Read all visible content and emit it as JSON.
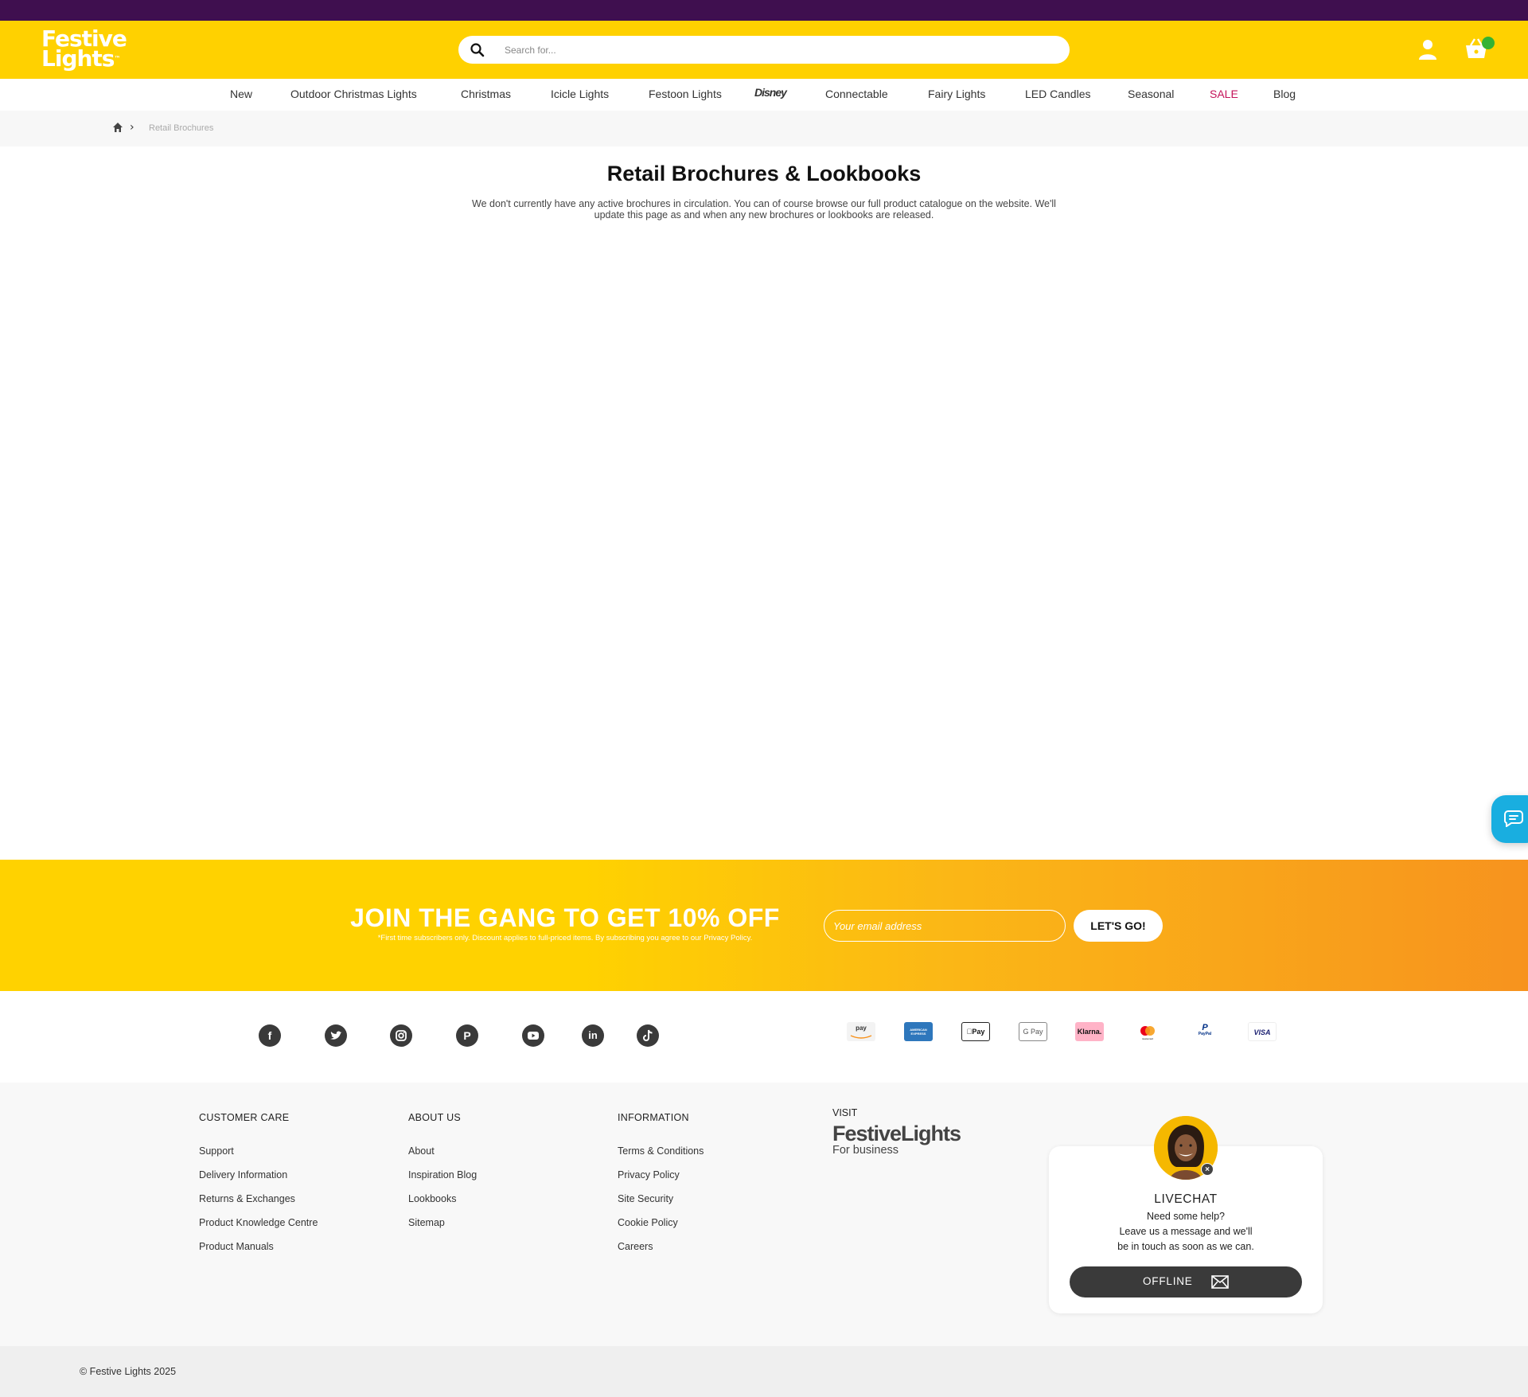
{
  "header": {
    "logo_line1": "Festive",
    "logo_line2": "Lights",
    "search_placeholder": "Search for..."
  },
  "nav": {
    "items": [
      "New",
      "Outdoor Christmas Lights",
      "Christmas",
      "Icicle Lights",
      "Festoon Lights",
      "Disney",
      "Connectable",
      "Fairy Lights",
      "LED Candles",
      "Seasonal",
      "SALE",
      "Blog"
    ]
  },
  "breadcrumb": {
    "current": "Retail Brochures"
  },
  "main": {
    "title": "Retail Brochures & Lookbooks",
    "description": "We don't currently have any active brochures in circulation. You can of course browse our full product catalogue on the website. We'll update this page as and when any new brochures or lookbooks are released."
  },
  "newsletter": {
    "heading": "JOIN THE GANG TO GET 10% OFF",
    "subtext": "*First time subscribers only. Discount applies to full-priced items. By subscribing you agree to our Privacy Policy.",
    "email_placeholder": "Your email address",
    "button_label": "LET'S GO!"
  },
  "social": [
    "facebook-icon",
    "twitter-icon",
    "instagram-icon",
    "pinterest-icon",
    "youtube-icon",
    "linkedin-icon",
    "tiktok-icon"
  ],
  "payments": {
    "amazon": "pay",
    "amex": "AMERICAN EXPRESS",
    "applepay": "Pay",
    "googlepay": "G Pay",
    "klarna": "Klarna.",
    "mastercard": "mastercard",
    "paypal": "PayPal",
    "visa": "VISA"
  },
  "footer": {
    "customer_care": {
      "heading": "CUSTOMER CARE",
      "links": [
        "Support",
        "Delivery Information",
        "Returns & Exchanges",
        "Product Knowledge Centre",
        "Product Manuals"
      ]
    },
    "about_us": {
      "heading": "ABOUT US",
      "links": [
        "About",
        "Inspiration Blog",
        "Lookbooks",
        "Sitemap"
      ]
    },
    "information": {
      "heading": "INFORMATION",
      "links": [
        "Terms & Conditions",
        "Privacy Policy",
        "Site Security",
        "Cookie Policy",
        "Careers"
      ]
    },
    "visit_label": "VISIT",
    "business_logo_big": "FestiveLights",
    "business_logo_small": "For business"
  },
  "livechat": {
    "title": "LIVECHAT",
    "line1": "Need some help?",
    "line2": "Leave us a message and we'll",
    "line3": "be in touch as soon as we can.",
    "button_label": "OFFLINE"
  },
  "copyright": "© Festive Lights 2025",
  "colors": {
    "top_strip": "#3f0f4f",
    "brand_yellow": "#ffd100",
    "sale_red": "#c4145a",
    "chat_blue": "#19aee0",
    "cart_badge_green": "#34b233"
  }
}
